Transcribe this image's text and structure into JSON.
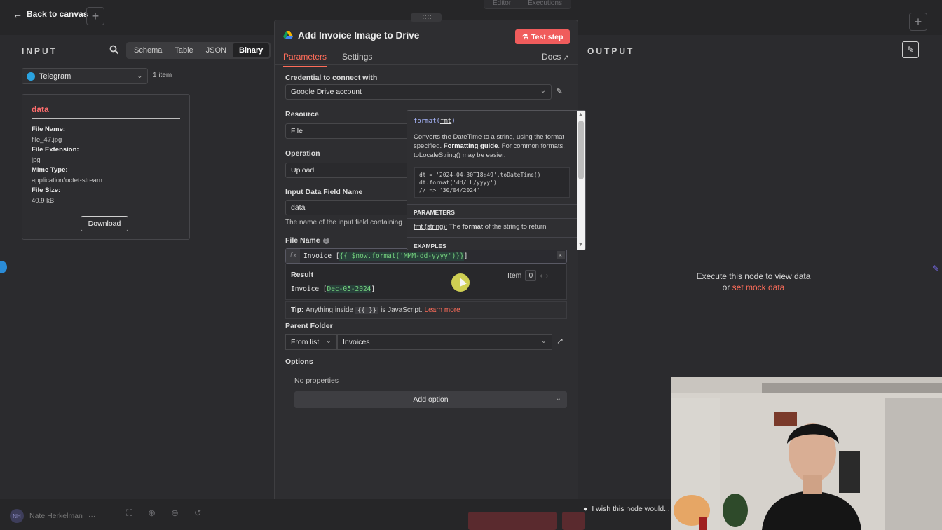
{
  "topbar": {
    "back_label": "Back to canvas",
    "add_symbol": "+",
    "tabs": [
      "Editor",
      "Executions"
    ]
  },
  "input": {
    "title": "INPUT",
    "mode_tabs": [
      "Schema",
      "Table",
      "JSON",
      "Binary"
    ],
    "active_mode": "Binary",
    "source": "Telegram",
    "item_count": "1 item",
    "binary": {
      "title": "data",
      "file_name_label": "File Name:",
      "file_name": "file_47.jpg",
      "file_ext_label": "File Extension:",
      "file_ext": "jpg",
      "mime_label": "Mime Type:",
      "mime": "application/octet-stream",
      "size_label": "File Size:",
      "size": "40.9 kB",
      "download": "Download"
    }
  },
  "dialog": {
    "drag_handle": ":::::",
    "title": "Add Invoice Image to Drive",
    "test_button": "Test step",
    "tabs": [
      "Parameters",
      "Settings"
    ],
    "active_tab": "Parameters",
    "docs": "Docs",
    "credential_label": "Credential to connect with",
    "credential_value": "Google Drive account",
    "resource_label": "Resource",
    "resource_value": "File",
    "operation_label": "Operation",
    "operation_value": "Upload",
    "input_field_label": "Input Data Field Name",
    "input_field_value": "data",
    "input_field_hint": "The name of the input field containing",
    "file_name_label": "File Name",
    "expr_prefix": "Invoice [",
    "expr_code": "{{ $now.format('MMM-dd-yyyy')}}",
    "expr_suffix": "]",
    "result_label": "Result",
    "result_prefix": "Invoice [",
    "result_value": "Dec-05-2024",
    "result_suffix": "]",
    "item_label": "Item",
    "item_index": "0",
    "tip_label": "Tip:",
    "tip_text": "Anything inside",
    "tip_code": "{{ }}",
    "tip_text2": "is JavaScript.",
    "tip_link": "Learn more",
    "parent_folder_label": "Parent Folder",
    "parent_mode": "From list",
    "parent_value": "Invoices",
    "options_label": "Options",
    "no_properties": "No properties",
    "add_option": "Add option"
  },
  "tooltip": {
    "sig_fn": "format(",
    "sig_arg": "fmt",
    "sig_close": ")",
    "desc_1": "Converts the DateTime to a string, using the format specified.",
    "desc_link": "Formatting guide",
    "desc_2": ". For common formats, toLocaleString() may be easier.",
    "code": "dt = '2024-04-30T18:49'.toDateTime()\ndt.format('dd/LL/yyyy')\n// => '30/04/2024'",
    "params_heading": "PARAMETERS",
    "param_name": "fmt (string):",
    "param_pre": "The",
    "param_bold": "format",
    "param_post": "of the string to return",
    "examples_heading": "EXAMPLES"
  },
  "output": {
    "title": "OUTPUT",
    "exec_msg": "Execute this node to view data",
    "or": "or",
    "mock_link": "set mock data"
  },
  "bottombar": {
    "user_initials": "NH",
    "user_name": "Nate Herkelman",
    "more": "···",
    "wish": "I wish this node would..."
  },
  "colors": {
    "accent": "#ff6d5a",
    "test_button": "#f05c5c",
    "expr_green": "#77d37f",
    "tooltip_sig": "#a9b8ff"
  }
}
